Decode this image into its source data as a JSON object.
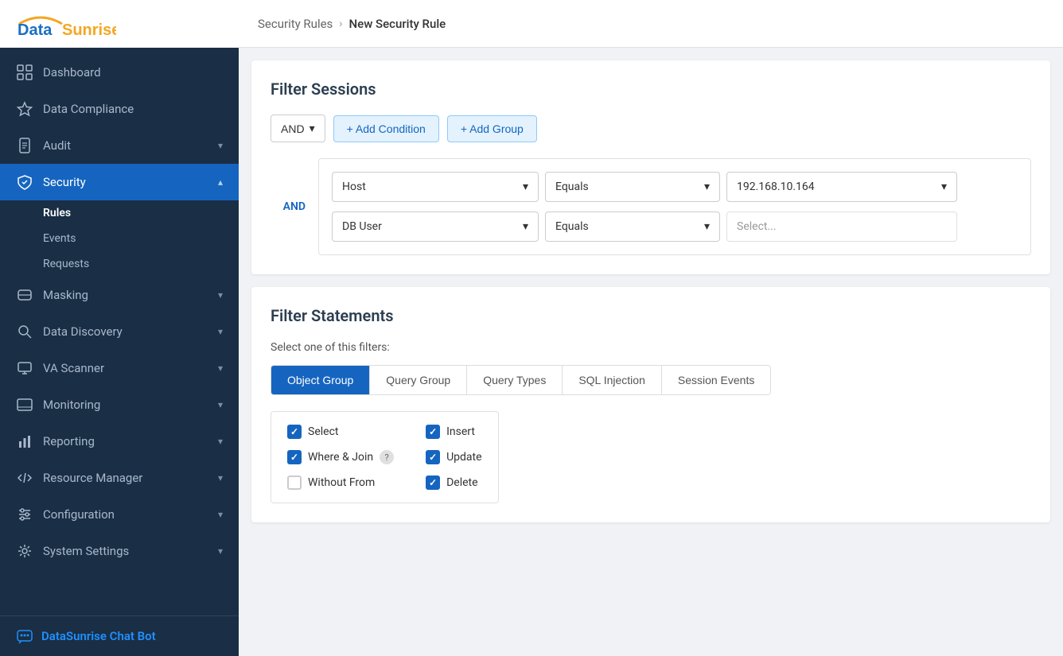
{
  "sidebar": {
    "logo": {
      "data": "Data",
      "sunrise": "Sunrise"
    },
    "nav_items": [
      {
        "id": "dashboard",
        "label": "Dashboard",
        "icon": "grid",
        "active": false,
        "expandable": false
      },
      {
        "id": "data-compliance",
        "label": "Data Compliance",
        "icon": "star",
        "active": false,
        "expandable": false
      },
      {
        "id": "audit",
        "label": "Audit",
        "icon": "file",
        "active": false,
        "expandable": true
      },
      {
        "id": "security",
        "label": "Security",
        "icon": "shield",
        "active": true,
        "expandable": true
      },
      {
        "id": "masking",
        "label": "Masking",
        "icon": "mask",
        "active": false,
        "expandable": true
      },
      {
        "id": "data-discovery",
        "label": "Data Discovery",
        "icon": "search",
        "active": false,
        "expandable": true
      },
      {
        "id": "va-scanner",
        "label": "VA Scanner",
        "icon": "monitor",
        "active": false,
        "expandable": true
      },
      {
        "id": "monitoring",
        "label": "Monitoring",
        "icon": "display",
        "active": false,
        "expandable": true
      },
      {
        "id": "reporting",
        "label": "Reporting",
        "icon": "chart",
        "active": false,
        "expandable": true
      },
      {
        "id": "resource-manager",
        "label": "Resource Manager",
        "icon": "code",
        "active": false,
        "expandable": true
      },
      {
        "id": "configuration",
        "label": "Configuration",
        "icon": "sliders",
        "active": false,
        "expandable": true
      },
      {
        "id": "system-settings",
        "label": "System Settings",
        "icon": "gear",
        "active": false,
        "expandable": true
      }
    ],
    "sub_items": [
      {
        "label": "Rules",
        "active": true
      },
      {
        "label": "Events",
        "active": false
      },
      {
        "label": "Requests",
        "active": false
      }
    ],
    "chatbot_label": "DataSunrise Chat Bot"
  },
  "breadcrumb": {
    "parent": "Security Rules",
    "separator": "›",
    "current": "New Security Rule"
  },
  "filter_sessions": {
    "title": "Filter Sessions",
    "and_label": "AND",
    "add_condition_label": "+ Add Condition",
    "add_group_label": "+ Add Group",
    "and_connector": "AND",
    "rows": [
      {
        "field": "Host",
        "operator": "Equals",
        "value": "192.168.10.164",
        "value_placeholder": ""
      },
      {
        "field": "DB User",
        "operator": "Equals",
        "value": "",
        "value_placeholder": "Select..."
      }
    ]
  },
  "filter_statements": {
    "title": "Filter Statements",
    "select_label": "Select one of this filters:",
    "tabs": [
      {
        "id": "object-group",
        "label": "Object Group",
        "active": true
      },
      {
        "id": "query-group",
        "label": "Query Group",
        "active": false
      },
      {
        "id": "query-types",
        "label": "Query Types",
        "active": false
      },
      {
        "id": "sql-injection",
        "label": "SQL Injection",
        "active": false
      },
      {
        "id": "session-events",
        "label": "Session Events",
        "active": false
      }
    ],
    "checkboxes_left": [
      {
        "label": "Select",
        "checked": true
      },
      {
        "label": "Where & Join",
        "checked": true,
        "has_help": true
      },
      {
        "label": "Without From",
        "checked": false
      }
    ],
    "checkboxes_right": [
      {
        "label": "Insert",
        "checked": true
      },
      {
        "label": "Update",
        "checked": true
      },
      {
        "label": "Delete",
        "checked": true
      }
    ]
  }
}
